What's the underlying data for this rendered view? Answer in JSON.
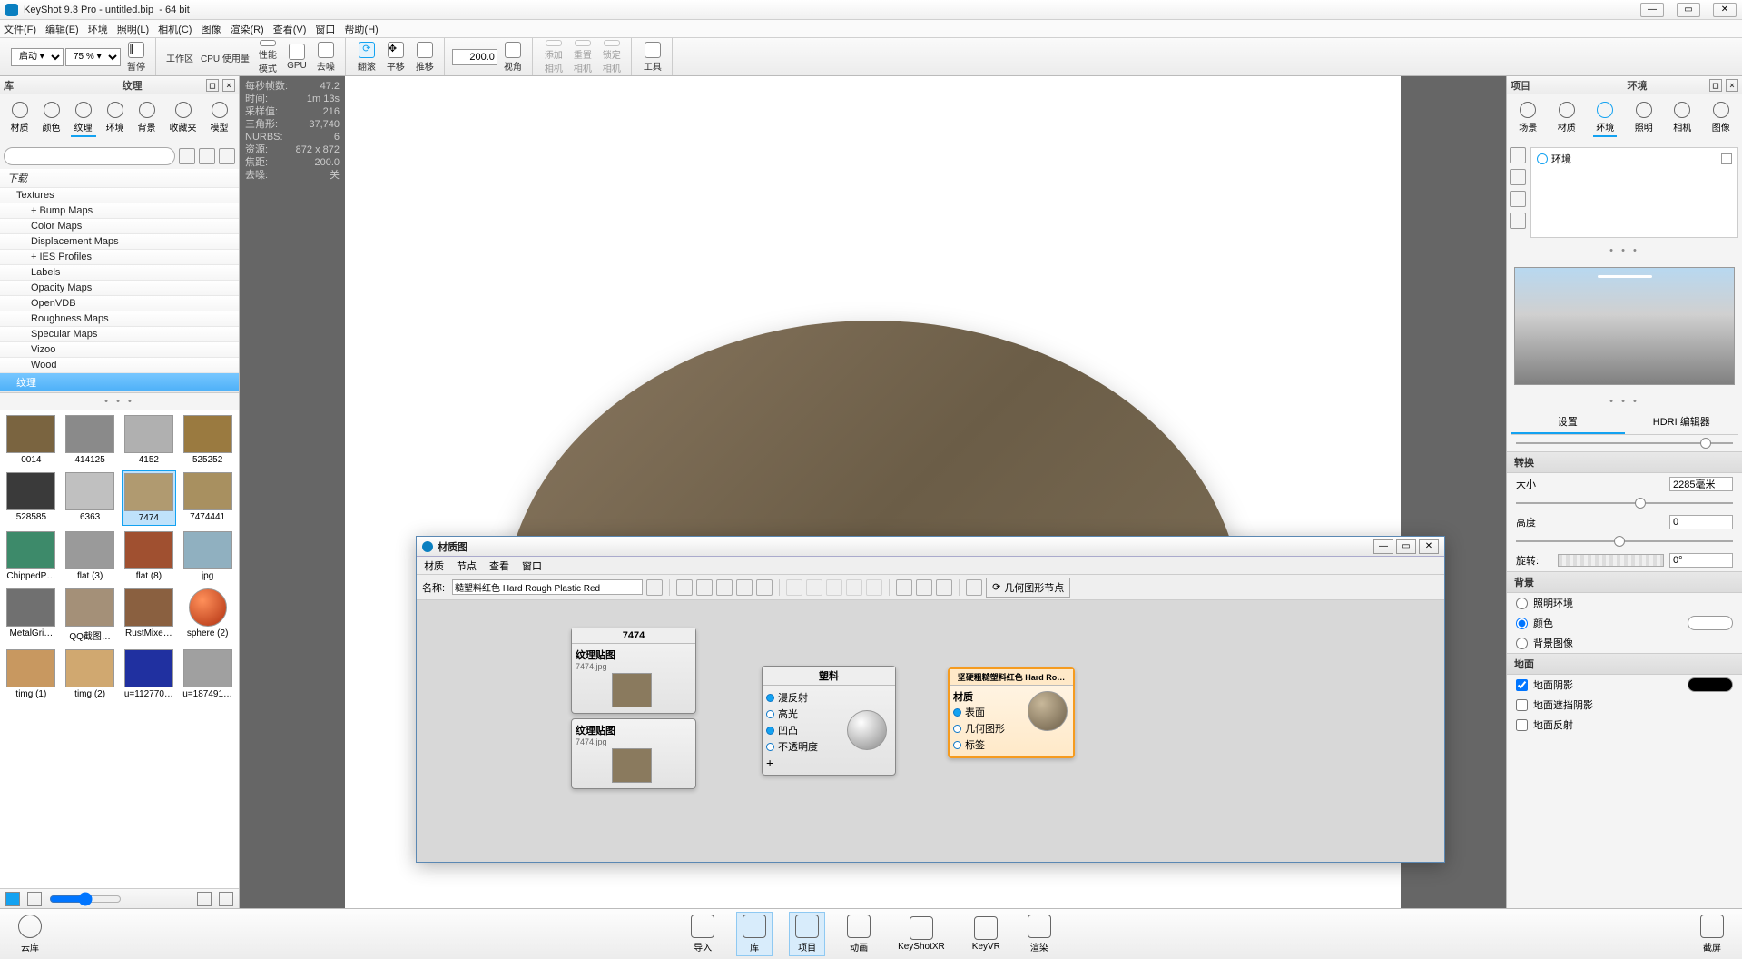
{
  "titlebar": {
    "app": "KeyShot 9.3 Pro",
    "doc": "untitled.bip",
    "arch": "64 bit"
  },
  "menu": [
    "文件(F)",
    "编辑(E)",
    "环境",
    "照明(L)",
    "相机(C)",
    "图像",
    "渲染(R)",
    "查看(V)",
    "窗口",
    "帮助(H)"
  ],
  "toolbar": {
    "combo_launch": "启动 ▾",
    "combo_pct": "75 % ▾",
    "pause": "暂停",
    "workspace": "工作区",
    "cpu_usage": "CPU 使用量",
    "perf_mode": "性能\n模式",
    "gpu": "GPU",
    "denoise": "去噪",
    "tumble": "翻滚",
    "pan": "平移",
    "dolly": "推移",
    "fov_lbl": "视角",
    "fov_val": "200.0",
    "add_cam": "添加\n相机",
    "reset_cam": "重置\n相机",
    "lock_cam": "锁定\n相机",
    "tools": "工具"
  },
  "lib": {
    "panel_left_label": "库",
    "panel_title": "纹理",
    "tabs": [
      "材质",
      "颜色",
      "纹理",
      "环境",
      "背景",
      "收藏夹",
      "模型"
    ],
    "search_placeholder": "",
    "tree": [
      {
        "label": "下载",
        "level": 1
      },
      {
        "label": "Textures",
        "level": 2
      },
      {
        "label": "Bump Maps",
        "level": 3,
        "expand": "+"
      },
      {
        "label": "Color Maps",
        "level": 3
      },
      {
        "label": "Displacement Maps",
        "level": 3
      },
      {
        "label": "IES Profiles",
        "level": 3,
        "expand": "+"
      },
      {
        "label": "Labels",
        "level": 3
      },
      {
        "label": "Opacity Maps",
        "level": 3
      },
      {
        "label": "OpenVDB",
        "level": 3
      },
      {
        "label": "Roughness Maps",
        "level": 3
      },
      {
        "label": "Specular Maps",
        "level": 3
      },
      {
        "label": "Vizoo",
        "level": 3
      },
      {
        "label": "Wood",
        "level": 3
      },
      {
        "label": "纹理",
        "level": 2,
        "selected": true
      }
    ],
    "thumbs": [
      {
        "cap": "0014",
        "bg": "#7a6440"
      },
      {
        "cap": "414125",
        "bg": "#8a8a8a"
      },
      {
        "cap": "4152",
        "bg": "#b0b0b0"
      },
      {
        "cap": "525252",
        "bg": "#9a7a40"
      },
      {
        "cap": "528585",
        "bg": "#3a3a3a"
      },
      {
        "cap": "6363",
        "bg": "#c0c0c0"
      },
      {
        "cap": "7474",
        "bg": "#b09a70",
        "selected": true
      },
      {
        "cap": "7474441",
        "bg": "#a89060"
      },
      {
        "cap": "ChippedP…",
        "bg": "#3d8a6a"
      },
      {
        "cap": "flat (3)",
        "bg": "#9a9a9a"
      },
      {
        "cap": "flat (8)",
        "bg": "#a05030"
      },
      {
        "cap": "jpg",
        "bg": "#90b0c0"
      },
      {
        "cap": "MetalGri…",
        "bg": "#707070"
      },
      {
        "cap": "QQ截图…",
        "bg": "#a49078"
      },
      {
        "cap": "RustMixe…",
        "bg": "#8a6040"
      },
      {
        "cap": "sphere (2)",
        "bg": "radial-gradient(circle at 35% 30%,#ff905a,#b03010)",
        "round": true
      },
      {
        "cap": "timg (1)",
        "bg": "#c89860"
      },
      {
        "cap": "timg (2)",
        "bg": "#d0a870"
      },
      {
        "cap": "u=112770…",
        "bg": "#2030a0"
      },
      {
        "cap": "u=187491…",
        "bg": "#a0a0a0"
      }
    ]
  },
  "stats": {
    "rows": [
      {
        "k": "每秒帧数:",
        "v": "47.2"
      },
      {
        "k": "时间:",
        "v": "1m 13s"
      },
      {
        "k": "采样值:",
        "v": "216"
      },
      {
        "k": "三角形:",
        "v": "37,740"
      },
      {
        "k": "NURBS:",
        "v": "6"
      },
      {
        "k": "资源:",
        "v": "872 x 872"
      },
      {
        "k": "焦距:",
        "v": "200.0"
      },
      {
        "k": "去噪:",
        "v": "关"
      }
    ]
  },
  "proj": {
    "panel_left_label": "项目",
    "panel_title": "环境",
    "tabs": [
      "场景",
      "材质",
      "环境",
      "照明",
      "相机",
      "图像"
    ],
    "env_item": "环境",
    "settings_tabs": [
      "设置",
      "HDRI 编辑器"
    ],
    "section_transform": "转换",
    "fields": {
      "size_lbl": "大小",
      "size_val": "2285毫米",
      "height_lbl": "高度",
      "height_val": "0",
      "rotate_lbl": "旋转:",
      "rotate_val": "0°"
    },
    "section_bg": "背景",
    "bg_radios": [
      "照明环境",
      "颜色",
      "背景图像"
    ],
    "section_ground": "地面",
    "ground_checks": [
      {
        "lbl": "地面阴影",
        "checked": true
      },
      {
        "lbl": "地面遮挡阴影",
        "checked": false
      },
      {
        "lbl": "地面反射",
        "checked": false
      }
    ]
  },
  "bottombar": {
    "cloud": "云库",
    "btns": [
      "导入",
      "库",
      "项目",
      "动画",
      "KeyShotXR",
      "KeyVR",
      "渲染"
    ],
    "screenshot": "截屏"
  },
  "matwin": {
    "title": "材质图",
    "menu": [
      "材质",
      "节点",
      "查看",
      "窗口"
    ],
    "name_lbl": "名称:",
    "name_val": "糙塑料红色 Hard Rough Plastic Red",
    "geom_btn": "几何图形节点",
    "nodes": {
      "tex1": {
        "hdr": "7474",
        "sub": "纹理贴图",
        "file": "7474.jpg"
      },
      "tex2": {
        "sub": "纹理贴图",
        "file": "7474.jpg"
      },
      "plastic": {
        "hdr": "塑料",
        "ports": [
          "漫反射",
          "高光",
          "凹凸",
          "不透明度"
        ]
      },
      "mat": {
        "hdr": "坚硬粗糙塑料红色 Hard Ro…",
        "sub": "材质",
        "ports": [
          "表面",
          "几何图形",
          "标签"
        ]
      }
    }
  }
}
